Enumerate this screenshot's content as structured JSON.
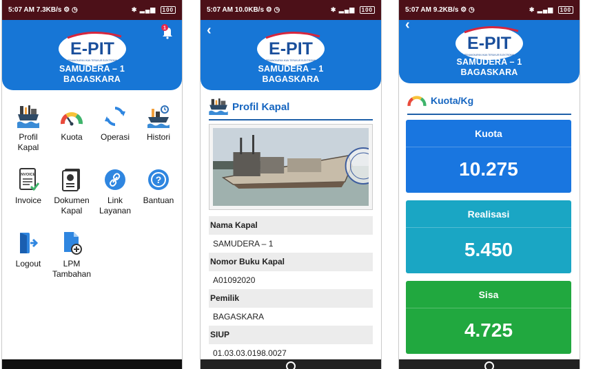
{
  "screens": {
    "home": {
      "status": {
        "time": "5:07 AM",
        "speed": "7.3KB/s",
        "battery": "100"
      },
      "header": {
        "logo_text": "E-PIT",
        "logo_sub": "PENANGKAPAN IKAN TERUKUR ELEKTRONIK",
        "line1": "SAMUDERA – 1",
        "line2": "BAGASKARA"
      },
      "notification_count": "1",
      "menu": [
        {
          "label": "Profil\nKapal",
          "icon": "ship-profile-icon"
        },
        {
          "label": "Kuota",
          "icon": "gauge-icon"
        },
        {
          "label": "Operasi",
          "icon": "sync-icon"
        },
        {
          "label": "Histori",
          "icon": "history-ship-icon"
        },
        {
          "label": "Invoice",
          "icon": "invoice-icon"
        },
        {
          "label": "Dokumen\nKapal",
          "icon": "document-icon"
        },
        {
          "label": "Link\nLayanan",
          "icon": "link-icon"
        },
        {
          "label": "Bantuan",
          "icon": "help-icon"
        },
        {
          "label": "Logout",
          "icon": "logout-icon"
        },
        {
          "label": "LPM\nTambahan",
          "icon": "add-file-icon"
        }
      ]
    },
    "profile": {
      "status": {
        "time": "5:07 AM",
        "speed": "10.0KB/s",
        "battery": "100"
      },
      "header": {
        "logo_text": "E-PIT",
        "logo_sub": "PENANGKAPAN IKAN TERUKUR ELEKTRONIK",
        "line1": "SAMUDERA – 1",
        "line2": "BAGASKARA"
      },
      "section_title": "Profil Kapal",
      "fields": [
        {
          "label": "Nama Kapal",
          "value": "SAMUDERA – 1"
        },
        {
          "label": "Nomor Buku Kapal",
          "value": "A01092020"
        },
        {
          "label": "Pemilik",
          "value": "BAGASKARA"
        },
        {
          "label": "SIUP",
          "value": "01.03.03.0198.0027"
        }
      ]
    },
    "quota": {
      "status": {
        "time": "5:07 AM",
        "speed": "9.2KB/s",
        "battery": "100"
      },
      "header": {
        "logo_text": "E-PIT",
        "logo_sub": "PENANGKAPAN IKAN TERUKUR ELEKTRONIK",
        "line1": "SAMUDERA – 1",
        "line2": "BAGASKARA"
      },
      "section_title": "Kuota/Kg",
      "cards": [
        {
          "title": "Kuota",
          "value": "10.275",
          "color": "#1976e0"
        },
        {
          "title": "Realisasi",
          "value": "5.450",
          "color": "#1aa6c4"
        },
        {
          "title": "Sisa",
          "value": "4.725",
          "color": "#21a83f"
        }
      ]
    }
  }
}
